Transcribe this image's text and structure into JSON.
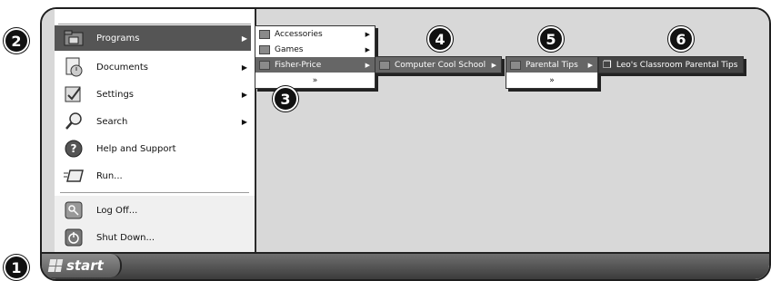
{
  "start_menu": {
    "items": [
      {
        "label": "Programs",
        "icon": "programs-folder-icon",
        "has_arrow": true,
        "selected": true
      },
      {
        "label": "Documents",
        "icon": "documents-icon",
        "has_arrow": true
      },
      {
        "label": "Settings",
        "icon": "settings-icon",
        "has_arrow": true
      },
      {
        "label": "Search",
        "icon": "search-icon",
        "has_arrow": true
      },
      {
        "label": "Help and Support",
        "icon": "help-icon",
        "has_arrow": false
      },
      {
        "label": "Run...",
        "icon": "run-icon",
        "has_arrow": false
      }
    ],
    "bottom": [
      {
        "label": "Log Off...",
        "icon": "log-off-icon"
      },
      {
        "label": "Shut Down...",
        "icon": "shut-down-icon"
      }
    ]
  },
  "programs_menu": {
    "items": [
      {
        "label": "Accessories",
        "has_arrow": true
      },
      {
        "label": "Games",
        "has_arrow": true
      },
      {
        "label": "Fisher-Price",
        "has_arrow": true,
        "selected": true
      }
    ],
    "expand": "»"
  },
  "fisher_price_menu": {
    "items": [
      {
        "label": "Computer Cool School",
        "has_arrow": true,
        "selected": true
      }
    ]
  },
  "cool_school_menu": {
    "items": [
      {
        "label": "Parental Tips",
        "has_arrow": true,
        "selected": true
      }
    ],
    "expand": "»"
  },
  "parental_tips_menu": {
    "items": [
      {
        "label": "Leo's Classroom Parental Tips",
        "icon": "document-help-icon",
        "selected": true
      }
    ]
  },
  "taskbar": {
    "start_label": "start"
  },
  "callouts": [
    "1",
    "2",
    "3",
    "4",
    "5",
    "6"
  ]
}
